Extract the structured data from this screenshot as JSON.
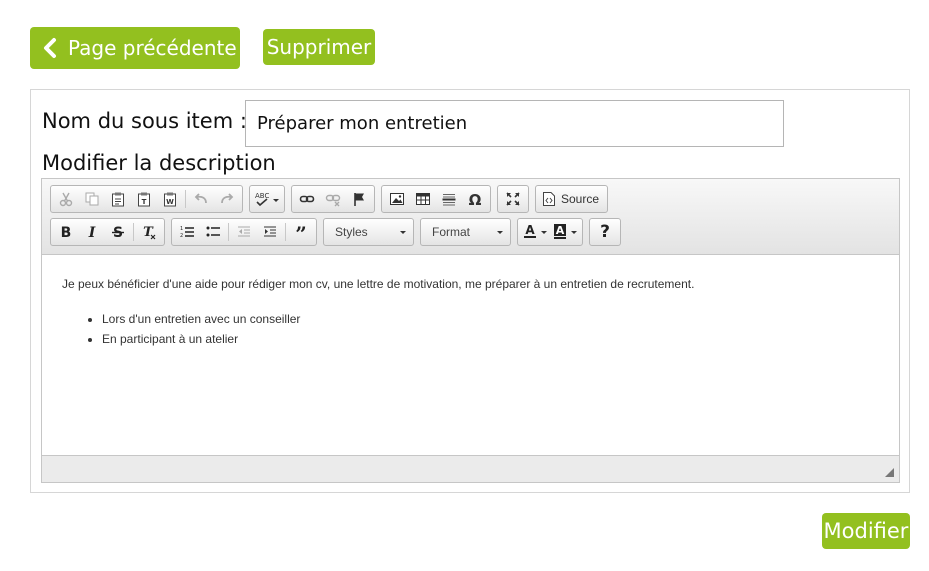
{
  "buttons": {
    "back": "Page précédente",
    "delete": "Supprimer",
    "modify": "Modifier"
  },
  "form": {
    "name_label": "Nom du sous item :",
    "name_value": "Préparer mon entretien",
    "description_label": "Modifier la description"
  },
  "editor": {
    "toolbar": {
      "source_label": "Source",
      "styles_label": "Styles",
      "format_label": "Format",
      "help_label": "?",
      "spell_text": "ABC"
    },
    "content": {
      "paragraph": "Je peux bénéficier d'une aide pour rédiger mon cv, une lettre de motivation, me préparer à un entretien de recrutement.",
      "list": [
        "Lors d'un entretien avec un conseiller",
        "En participant à un atelier"
      ]
    }
  },
  "colors": {
    "accent": "#93c01f",
    "toolbar": "#e9e9e9",
    "border": "#c6c6c6"
  }
}
